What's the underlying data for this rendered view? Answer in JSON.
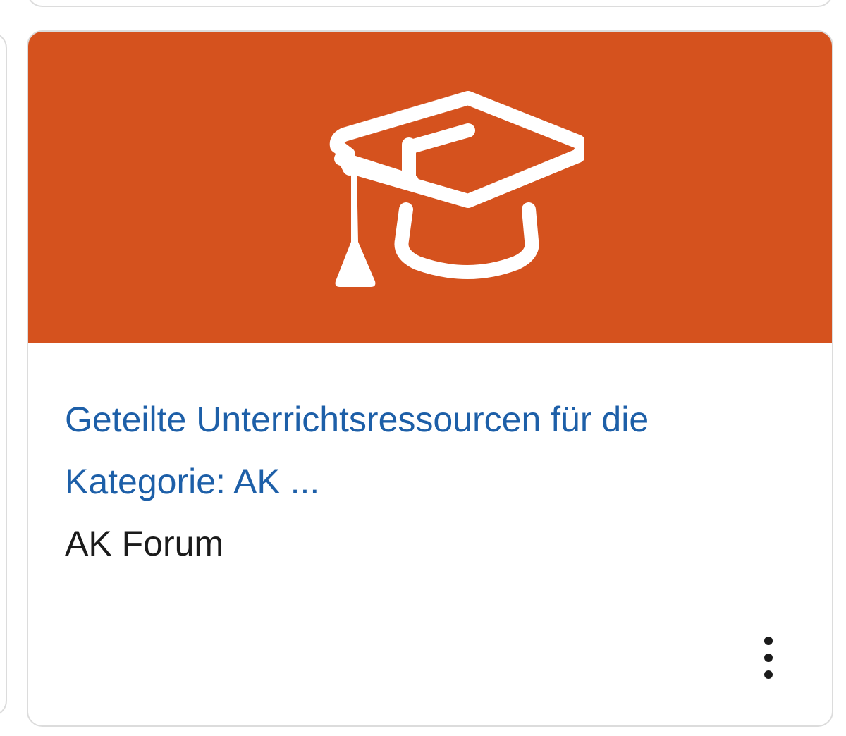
{
  "colors": {
    "card_image_background": "#d5521e",
    "title_link": "#1d5fa8",
    "text": "#1b1b1b",
    "card_border": "#dcdcdc"
  },
  "course_card": {
    "icon": "graduation-cap-icon",
    "title": "Geteilte Unterrichtsressourcen für die Kategorie: AK ...",
    "category": "AK Forum",
    "menu_icon": "kebab-menu-icon"
  }
}
